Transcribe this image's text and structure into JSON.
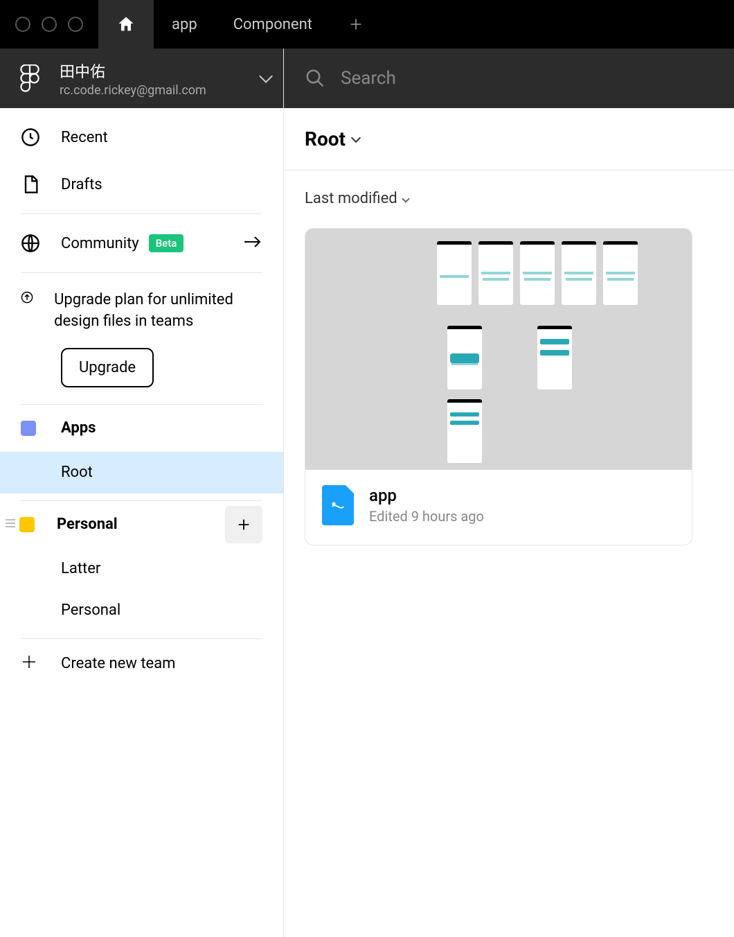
{
  "tabs": {
    "app": "app",
    "component": "Component"
  },
  "user": {
    "name": "田中佑",
    "email": "rc.code.rickey@gmail.com"
  },
  "nav": {
    "recent": "Recent",
    "drafts": "Drafts",
    "community": "Community",
    "community_badge": "Beta"
  },
  "upgrade": {
    "text": "Upgrade plan for unlimited design files in teams",
    "button": "Upgrade"
  },
  "teams": {
    "apps": {
      "name": "Apps",
      "color": "#7b91f5",
      "projects": [
        {
          "name": "Root"
        }
      ]
    },
    "personal": {
      "name": "Personal",
      "color": "#ffc700",
      "projects": [
        {
          "name": "Latter"
        },
        {
          "name": "Personal"
        }
      ]
    }
  },
  "create_team": "Create new team",
  "search": {
    "placeholder": "Search"
  },
  "breadcrumb": "Root",
  "sort": {
    "label": "Last modified"
  },
  "files": [
    {
      "title": "app",
      "time": "Edited 9 hours ago"
    }
  ]
}
